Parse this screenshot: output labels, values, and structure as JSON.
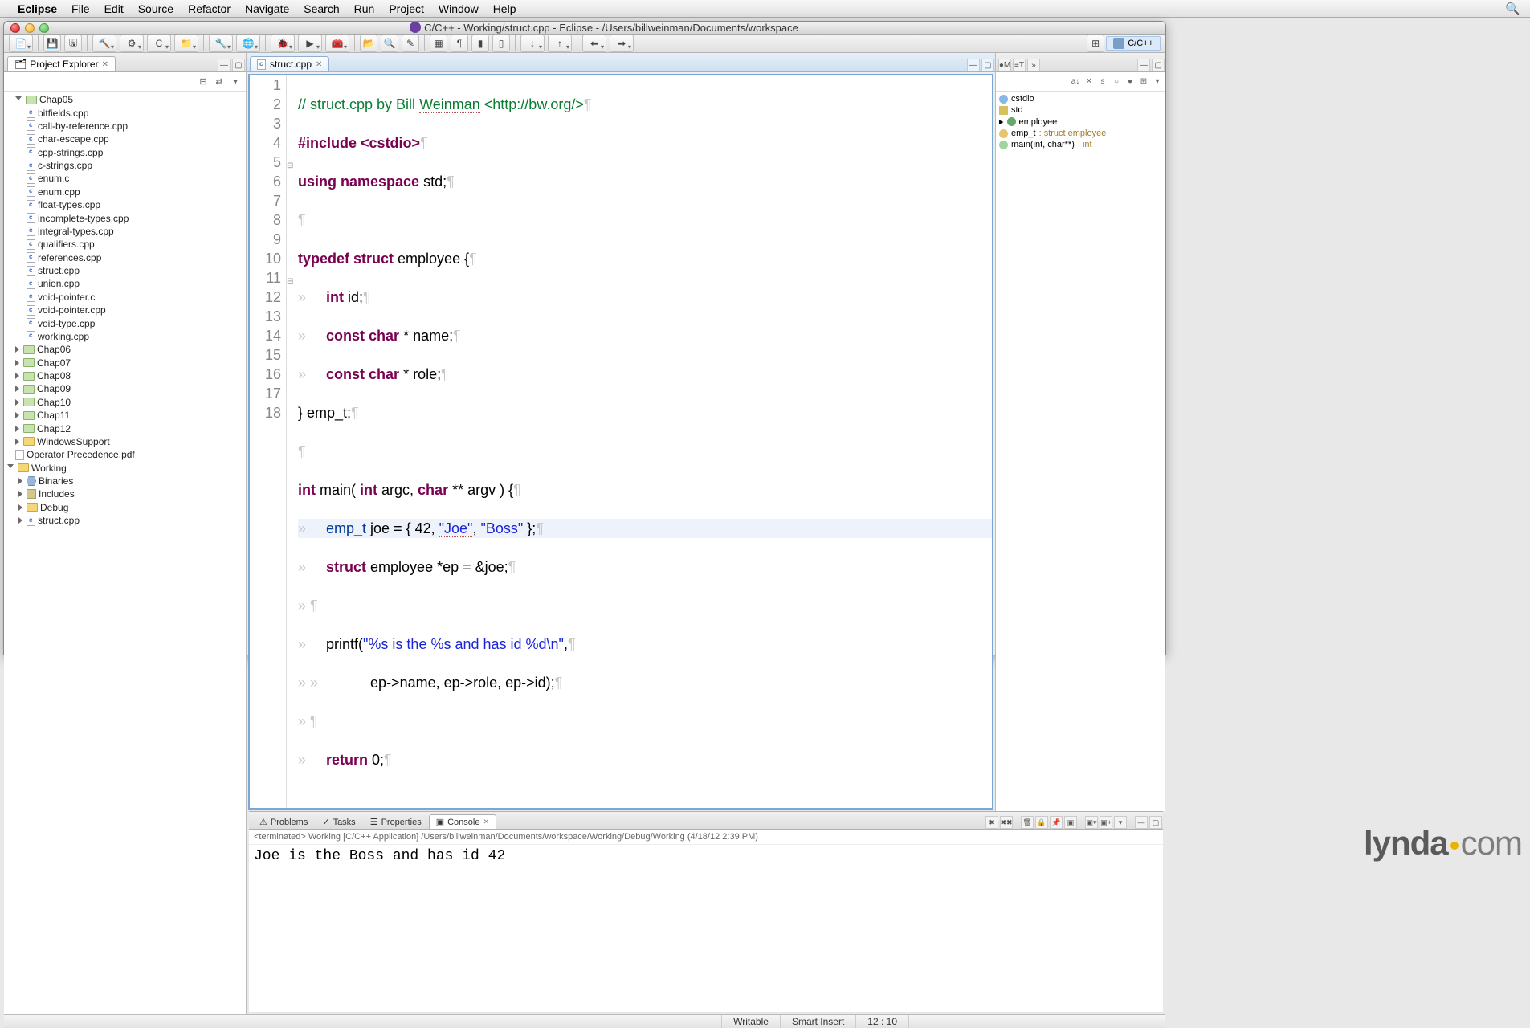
{
  "menubar": {
    "app": "Eclipse",
    "items": [
      "File",
      "Edit",
      "Source",
      "Refactor",
      "Navigate",
      "Search",
      "Run",
      "Project",
      "Window",
      "Help"
    ]
  },
  "window": {
    "title": "C/C++ - Working/struct.cpp - Eclipse - /Users/billweinman/Documents/workspace"
  },
  "perspective": {
    "label": "C/C++"
  },
  "project_explorer": {
    "title": "Project Explorer",
    "tree": {
      "chap05": "Chap05",
      "chap05_files": [
        "bitfields.cpp",
        "call-by-reference.cpp",
        "char-escape.cpp",
        "cpp-strings.cpp",
        "c-strings.cpp",
        "enum.c",
        "enum.cpp",
        "float-types.cpp",
        "incomplete-types.cpp",
        "integral-types.cpp",
        "qualifiers.cpp",
        "references.cpp",
        "struct.cpp",
        "union.cpp",
        "void-pointer.c",
        "void-pointer.cpp",
        "void-type.cpp",
        "working.cpp"
      ],
      "chaps": [
        "Chap06",
        "Chap07",
        "Chap08",
        "Chap09",
        "Chap10",
        "Chap11",
        "Chap12"
      ],
      "windows_support": "WindowsSupport",
      "operator_pdf": "Operator Precedence.pdf",
      "working": "Working",
      "working_items": [
        "Binaries",
        "Includes",
        "Debug",
        "struct.cpp"
      ]
    }
  },
  "editor": {
    "tab": "struct.cpp",
    "lines": {
      "l1a": "// struct.cpp by Bill ",
      "l1b": "Weinman",
      "l1c": " <http://bw.org/>",
      "l2a": "#include",
      "l2b": " <cstdio>",
      "l3a": "using",
      "l3b": " namespace",
      "l3c": " std;",
      "l5a": "typedef",
      "l5b": " struct",
      "l5c": " employee {",
      "l6a": "    int",
      "l6b": " id;",
      "l7a": "    const",
      "l7b": " char",
      "l7c": " * name;",
      "l8a": "    const",
      "l8b": " char",
      "l8c": " * role;",
      "l9": "} emp_t;",
      "l11a": "int",
      "l11b": " main( ",
      "l11c": "int",
      "l11d": " argc, ",
      "l11e": "char",
      "l11f": " ** argv ) {",
      "l12a": "    emp_t",
      "l12b": " joe = { 42, ",
      "l12c": "\"Joe\"",
      "l12d": ", ",
      "l12e": "\"Boss\"",
      "l12f": " };",
      "l13a": "    struct",
      "l13b": " employee *ep = &joe;",
      "l15a": "    printf(",
      "l15b": "\"%s is the %s and has id %d\\n\"",
      "l15c": ",",
      "l16": "            ep->name, ep->role, ep->id);",
      "l18a": "    return",
      "l18b": " 0;"
    },
    "line_numbers": [
      "1",
      "2",
      "3",
      "4",
      "5",
      "6",
      "7",
      "8",
      "9",
      "10",
      "11",
      "12",
      "13",
      "14",
      "15",
      "16",
      "17",
      "18"
    ]
  },
  "outline": {
    "items": [
      {
        "label": "cstdio",
        "type": "inc"
      },
      {
        "label": "std",
        "type": "ns"
      },
      {
        "label": "employee",
        "type": "st"
      },
      {
        "label": "emp_t",
        "type": "td",
        "ret": ": struct employee"
      },
      {
        "label": "main(int, char**)",
        "type": "fn",
        "ret": ": int"
      }
    ],
    "tabs": {
      "m": "M",
      "t": "T",
      "more": "»"
    }
  },
  "bottom": {
    "tabs": [
      "Problems",
      "Tasks",
      "Properties",
      "Console"
    ],
    "header": "<terminated> Working [C/C++ Application] /Users/billweinman/Documents/workspace/Working/Debug/Working (4/18/12 2:39 PM)",
    "output": "Joe is the Boss and has id 42"
  },
  "status": {
    "writable": "Writable",
    "insert": "Smart Insert",
    "pos": "12 : 10"
  },
  "watermark": {
    "a": "lynda",
    "b": "com"
  }
}
